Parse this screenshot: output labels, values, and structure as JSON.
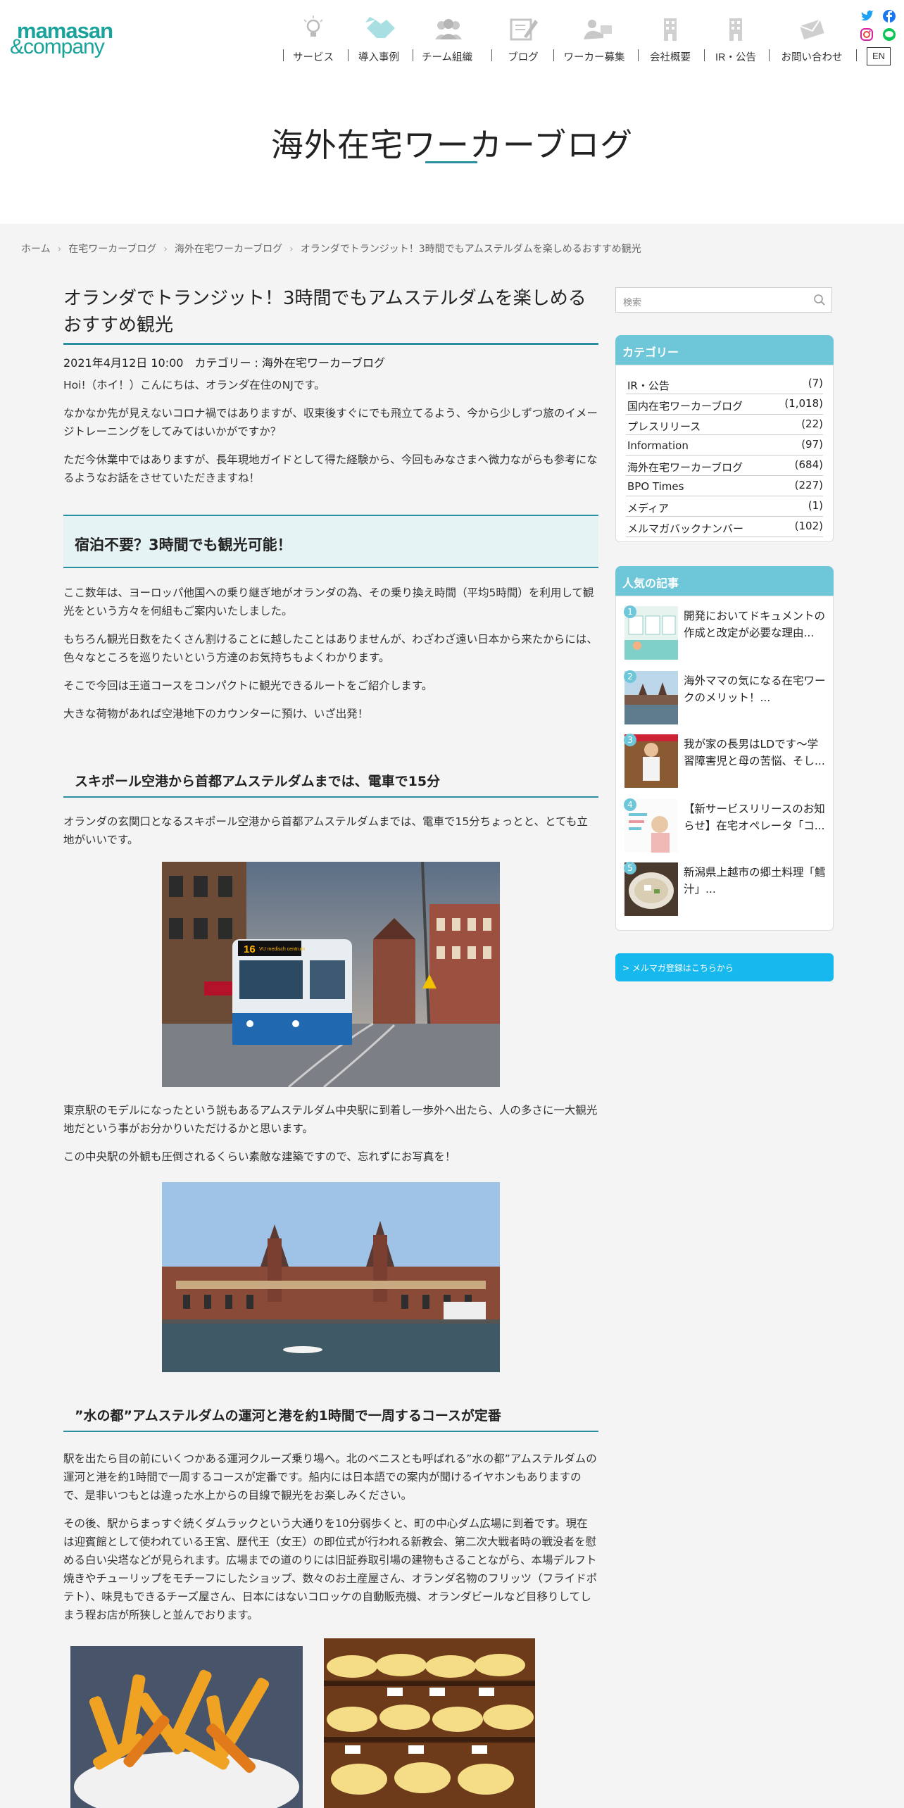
{
  "header": {
    "logo_line1": "mamasan",
    "logo_line2": "&company",
    "nav": [
      {
        "label": "サービス",
        "icon": "lightbulb-icon"
      },
      {
        "label": "導入事例",
        "icon": "handshake-icon"
      },
      {
        "label": "チーム組織",
        "icon": "team-icon"
      },
      {
        "label": "ブログ",
        "icon": "blog-pen-icon"
      },
      {
        "label": "ワーカー募集",
        "icon": "worker-icon"
      },
      {
        "label": "会社概要",
        "icon": "building-icon"
      },
      {
        "label": "IR・公告",
        "icon": "office-icon"
      },
      {
        "label": "お問い合わせ",
        "icon": "mail-icon"
      }
    ],
    "en_label": "EN",
    "sns": [
      "twitter-icon",
      "facebook-icon",
      "instagram-icon",
      "line-icon"
    ]
  },
  "hero": {
    "title": "海外在宅ワーカーブログ"
  },
  "breadcrumb": [
    "ホーム",
    "在宅ワーカーブログ",
    "海外在宅ワーカーブログ",
    "オランダでトランジット！3時間でもアムステルダムを楽しめるおすすめ観光"
  ],
  "post": {
    "title": "オランダでトランジット！3時間でもアムステルダムを楽しめるおすすめ観光",
    "meta": "2021年4月12日 10:00　カテゴリー : 海外在宅ワーカーブログ",
    "intro": [
      "Hoi!（ホイ！）こんにちは、オランダ在住のNJです。",
      "なかなか先が見えないコロナ禍ではありますが、収束後すぐにでも飛立てるよう、今から少しずつ旅のイメージトレーニングをしてみてはいかがですか？",
      "ただ今休業中ではありますが、長年現地ガイドとして得た経験から、今回もみなさまへ微力ながらも参考になるようなお話をさせていただきますね！"
    ],
    "section1_heading": "宿泊不要？3時間でも観光可能！",
    "section1": [
      "ここ数年は、ヨーロッパ他国への乗り継ぎ地がオランダの為、その乗り換え時間（平均5時間）を利用して観光をという方々を何組もご案内いたしました。",
      "もちろん観光日数をたくさん割けることに越したことはありませんが、わざわざ遠い日本から来たからには、色々なところを巡りたいという方達のお気持ちもよくわかります。",
      "そこで今回は王道コースをコンパクトに観光できるルートをご紹介します。",
      "大きな荷物があれば空港地下のカウンターに預け、いざ出発！"
    ],
    "section2_heading": "スキポール空港から首都アムステルダムまでは、電車で15分",
    "section2": [
      "オランダの玄関口となるスキポール空港から首都アムステルダムまでは、電車で15分ちょっとと、とても立地がいいです。"
    ],
    "tram_sign": "16",
    "tram_dest": "VU medisch centrum",
    "section2b": [
      "東京駅のモデルになったという説もあるアムステルダム中央駅に到着し一歩外へ出たら、人の多さに一大観光地だという事がお分かりいただけるかと思います。",
      "この中央駅の外観も圧倒されるくらい素敵な建築ですので、忘れずにお写真を！"
    ],
    "section3_heading": "”水の都”アムステルダムの運河と港を約1時間で一周するコースが定番",
    "section3": [
      "駅を出たら目の前にいくつかある運河クルーズ乗り場へ。北のベニスとも呼ばれる”水の都”アムステルダムの運河と港を約1時間で一周するコースが定番です。船内には日本語での案内が聞けるイヤホンもありますので、是非いつもとは違った水上からの目線で観光をお楽しみください。",
      "その後、駅からまっすぐ続くダムラックという大通りを10分弱歩くと、町の中心ダム広場に到着です。現在は迎賓館として使われている王宮、歴代王（女王）の即位式が行われる新教会、第二次大戦者時の戦没者を慰める白い尖塔などが見られます。広場までの道のりには旧証券取引場の建物もさることながら、本場デルフト焼きやチューリップをモチーフにしたショップ、数々のお土産屋さん、オランダ名物のフリッツ（フライドポテト）、味見もできるチーズ屋さん、日本にはないコロッケの自動販売機、オランダビールなど目移りしてしまう程お店が所狭しと並んでおります。"
    ]
  },
  "sidebar": {
    "search_placeholder": "検索",
    "category_title": "カテゴリー",
    "categories": [
      {
        "name": "IR・公告",
        "count": "(7)"
      },
      {
        "name": "国内在宅ワーカーブログ",
        "count": "(1,018)"
      },
      {
        "name": "プレスリリース",
        "count": "(22)"
      },
      {
        "name": "Information",
        "count": "(97)"
      },
      {
        "name": "海外在宅ワーカーブログ",
        "count": "(684)"
      },
      {
        "name": "BPO Times",
        "count": "(227)"
      },
      {
        "name": "メディア",
        "count": "(1)"
      },
      {
        "name": "メルマガバックナンバー",
        "count": "(102)"
      }
    ],
    "popular_title": "人気の記事",
    "popular": [
      {
        "rank": "1",
        "title": "開発においてドキュメントの作成と改定が必要な理由..."
      },
      {
        "rank": "2",
        "title": "海外ママの気になる在宅ワークのメリット！..."
      },
      {
        "rank": "3",
        "title": "我が家の長男はLDです～学習障害児と母の苦悩、そし..."
      },
      {
        "rank": "4",
        "title": "【新サービスリリースのお知らせ】在宅オペレータ「コ..."
      },
      {
        "rank": "5",
        "title": "新潟県上越市の郷土料理「鱈汁」..."
      }
    ],
    "magazine_button": "> メルマガ登録はこちらから"
  }
}
